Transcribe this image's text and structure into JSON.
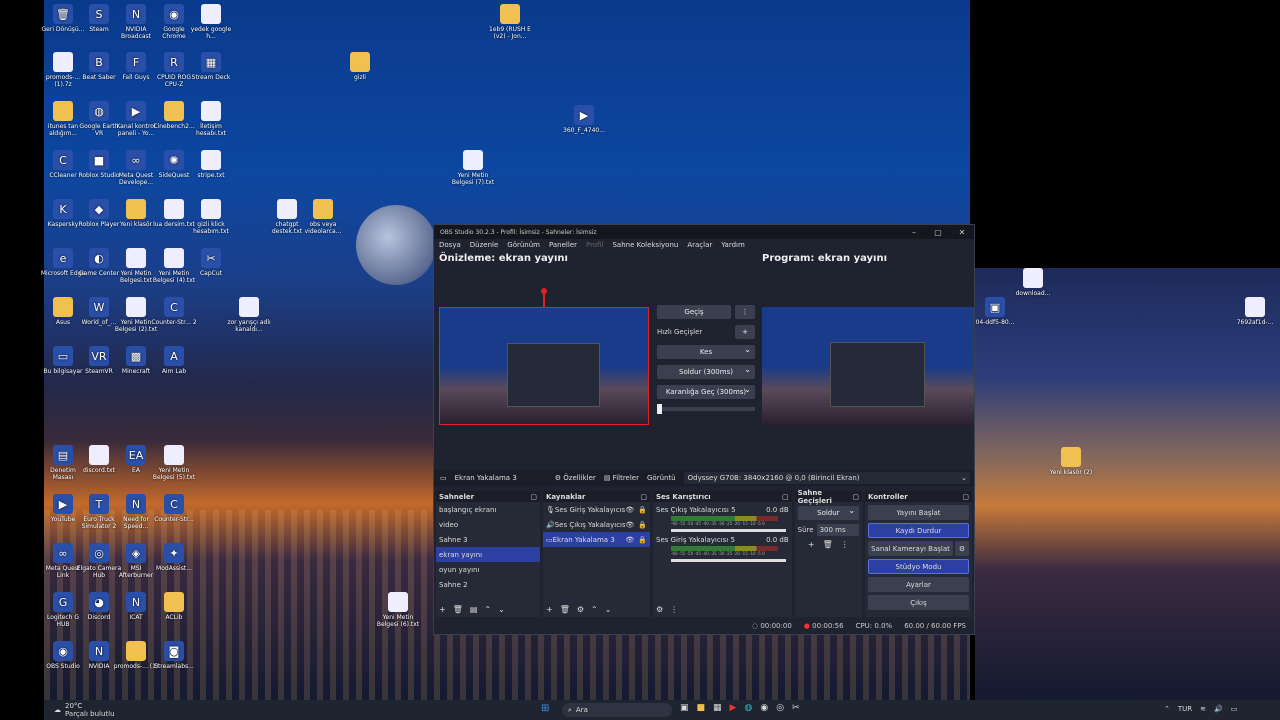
{
  "desktop": {
    "icons": [
      {
        "label": "Geri Dönüşü...",
        "glyph": "🗑",
        "kind": "app"
      },
      {
        "label": "Steam",
        "glyph": "S",
        "kind": "app"
      },
      {
        "label": "NVIDIA Broadcast",
        "glyph": "N",
        "kind": "app"
      },
      {
        "label": "Google Chrome",
        "glyph": "◉",
        "kind": "app"
      },
      {
        "label": "yedek google h...",
        "glyph": "",
        "kind": "file"
      },
      {
        "label": "promods-... (1).7z",
        "glyph": "",
        "kind": "file"
      },
      {
        "label": "Beat Saber",
        "glyph": "B",
        "kind": "app"
      },
      {
        "label": "Fall Guys",
        "glyph": "F",
        "kind": "app"
      },
      {
        "label": "CPUID ROG CPU-Z",
        "glyph": "R",
        "kind": "app"
      },
      {
        "label": "Stream Deck",
        "glyph": "▦",
        "kind": "app"
      },
      {
        "label": "itunes tan aldığım...",
        "glyph": "",
        "kind": "folder"
      },
      {
        "label": "Google Earth VR",
        "glyph": "◍",
        "kind": "app"
      },
      {
        "label": "Kanal kontrol paneli - Yo...",
        "glyph": "▶",
        "kind": "app"
      },
      {
        "label": "Cinebench2...",
        "glyph": "",
        "kind": "folder"
      },
      {
        "label": "İletişim hesabı.txt",
        "glyph": "",
        "kind": "file"
      },
      {
        "label": "CCleaner",
        "glyph": "C",
        "kind": "app"
      },
      {
        "label": "Roblox Studio",
        "glyph": "■",
        "kind": "app"
      },
      {
        "label": "Meta Quest Develope...",
        "glyph": "∞",
        "kind": "app"
      },
      {
        "label": "SideQuest",
        "glyph": "✺",
        "kind": "app"
      },
      {
        "label": "stripe.txt",
        "glyph": "",
        "kind": "file"
      },
      {
        "label": "Kaspersky",
        "glyph": "K",
        "kind": "app"
      },
      {
        "label": "Roblox Player",
        "glyph": "◆",
        "kind": "app"
      },
      {
        "label": "Yeni klasör",
        "glyph": "",
        "kind": "folder"
      },
      {
        "label": "lua dersim.txt",
        "glyph": "",
        "kind": "file"
      },
      {
        "label": "gizli klick hesabım.txt",
        "glyph": "",
        "kind": "file"
      },
      {
        "label": "Microsoft Edge",
        "glyph": "e",
        "kind": "app"
      },
      {
        "label": "Game Center",
        "glyph": "◐",
        "kind": "app"
      },
      {
        "label": "Yeni Metin Belgesi.txt",
        "glyph": "",
        "kind": "file"
      },
      {
        "label": "Yeni Metin Belgesi (4).txt",
        "glyph": "",
        "kind": "file"
      },
      {
        "label": "CapCut",
        "glyph": "✂",
        "kind": "app"
      },
      {
        "label": "Asus",
        "glyph": "",
        "kind": "folder"
      },
      {
        "label": "World_of_...",
        "glyph": "W",
        "kind": "app"
      },
      {
        "label": "Yeni Metin Belgesi (2).txt",
        "glyph": "",
        "kind": "file"
      },
      {
        "label": "Counter-Str... 2",
        "glyph": "C",
        "kind": "app"
      },
      {
        "label": "Bu bilgisayar",
        "glyph": "▭",
        "kind": "app"
      },
      {
        "label": "SteamVR",
        "glyph": "VR",
        "kind": "app"
      },
      {
        "label": "Minecraft",
        "glyph": "▩",
        "kind": "app"
      },
      {
        "label": "Aim Lab",
        "glyph": "A",
        "kind": "app"
      },
      {
        "label": "Denetim Masası",
        "glyph": "▤",
        "kind": "app"
      },
      {
        "label": "discord.txt",
        "glyph": "",
        "kind": "file"
      },
      {
        "label": "EA",
        "glyph": "EA",
        "kind": "app"
      },
      {
        "label": "Yeni Metin Belgesi (5).txt",
        "glyph": "",
        "kind": "file"
      },
      {
        "label": "YouTube",
        "glyph": "▶",
        "kind": "app"
      },
      {
        "label": "Euro Truck Simulator 2",
        "glyph": "T",
        "kind": "app"
      },
      {
        "label": "Need for Speed...",
        "glyph": "N",
        "kind": "app"
      },
      {
        "label": "Counter-Str...",
        "glyph": "C",
        "kind": "app"
      },
      {
        "label": "Meta Quest Link",
        "glyph": "∞",
        "kind": "app"
      },
      {
        "label": "Elgato Camera Hub",
        "glyph": "◎",
        "kind": "app"
      },
      {
        "label": "MSI Afterburner",
        "glyph": "◈",
        "kind": "app"
      },
      {
        "label": "ModAssist...",
        "glyph": "✦",
        "kind": "app"
      },
      {
        "label": "Logitech G HUB",
        "glyph": "G",
        "kind": "app"
      },
      {
        "label": "Discord",
        "glyph": "◕",
        "kind": "app"
      },
      {
        "label": "ICAT",
        "glyph": "N",
        "kind": "app"
      },
      {
        "label": "ACLib",
        "glyph": "",
        "kind": "folder"
      },
      {
        "label": "OBS Studio",
        "glyph": "◉",
        "kind": "app"
      },
      {
        "label": "NVIDIA",
        "glyph": "N",
        "kind": "app"
      },
      {
        "label": "promods-... (1)",
        "glyph": "",
        "kind": "folder"
      },
      {
        "label": "Streamlabs...",
        "glyph": "◙",
        "kind": "app"
      },
      {
        "label": "1eb9 (RUSH E (v2) - Jon...",
        "glyph": "",
        "kind": "folder"
      },
      {
        "label": "gizli",
        "glyph": "",
        "kind": "folder"
      },
      {
        "label": "360_F_4740...",
        "glyph": "▶",
        "kind": "app"
      },
      {
        "label": "Yeni Metin Belgesi (7).txt",
        "glyph": "",
        "kind": "file"
      },
      {
        "label": "chatgpt destek.txt",
        "glyph": "",
        "kind": "file"
      },
      {
        "label": "obs veya videolarca...",
        "glyph": "",
        "kind": "folder"
      },
      {
        "label": "zor yarışçı adlı kanaldı...",
        "glyph": "",
        "kind": "file"
      },
      {
        "label": "Yeni Metin Belgesi (6).txt",
        "glyph": "",
        "kind": "file"
      },
      {
        "label": "download...",
        "glyph": "",
        "kind": "file"
      },
      {
        "label": "04-ddf5-80...",
        "glyph": "▣",
        "kind": "app"
      },
      {
        "label": "7692af1d-...",
        "glyph": "",
        "kind": "file"
      },
      {
        "label": "Yeni klasör (2)",
        "glyph": "",
        "kind": "folder"
      }
    ]
  },
  "obs": {
    "title": "OBS Studio 30.2.3 - Profil: İsimsiz - Sahneler: İsimsiz",
    "menu": [
      "Dosya",
      "Düzenle",
      "Görünüm",
      "Paneller",
      "Profil",
      "Sahne Koleksiyonu",
      "Araçlar",
      "Yardım"
    ],
    "preview_header": "Önizleme: ekran yayını",
    "program_header": "Program: ekran yayını",
    "transitions": {
      "gecis": "Geçiş",
      "hizli": "Hızlı Geçişler",
      "kes": "Kes",
      "soldur": "Soldur (300ms)",
      "karanlik": "Karanlığa Geç (300ms)"
    },
    "source_bar": {
      "source": "Ekran Yakalama 3",
      "ozellikler": "Özellikler",
      "filtreler": "Filtreler",
      "goruntu_label": "Görüntü",
      "goruntu_value": "Odyssey G70B: 3840x2160 @ 0,0 (Birincil Ekran)"
    },
    "scenes": {
      "title": "Sahneler",
      "items": [
        "başlangıç ekranı",
        "video",
        "Sahne 3",
        "ekran yayını",
        "oyun yayını",
        "Sahne 2"
      ],
      "active": 3
    },
    "sources": {
      "title": "Kaynaklar",
      "items": [
        "Ses Giriş Yakalayıcısı",
        "Ses Çıkış Yakalayıcısı",
        "Ekran Yakalama 3"
      ]
    },
    "mixer": {
      "title": "Ses Karıştırıcı",
      "channels": [
        {
          "name": "Ses Çıkış Yakalayıcısı 5",
          "db": "0.0 dB"
        },
        {
          "name": "Ses Giriş Yakalayıcısı 5",
          "db": "0.0 dB"
        }
      ],
      "scale": "-60 -55 -50 -45 -40 -35 -30 -25 -20 -15 -10 -5 0"
    },
    "scene_transitions": {
      "title": "Sahne Geçişleri",
      "type": "Soldur",
      "duration_label": "Süre",
      "duration": "300 ms"
    },
    "controls": {
      "title": "Kontroller",
      "start_stream": "Yayını Başlat",
      "stop_record": "Kaydı Durdur",
      "virtual_cam": "Sanal Kamerayı Başlat",
      "studio_mode": "Stüdyo Modu",
      "settings": "Ayarlar",
      "exit": "Çıkış"
    },
    "status": {
      "stream_time": "00:00:00",
      "record_time": "00:00:56",
      "cpu": "CPU: 0.0%",
      "fps": "60.00 / 60.00 FPS"
    }
  },
  "taskbar": {
    "weather_temp": "20°C",
    "weather_text": "Parçalı bulutlu",
    "search": "Ara",
    "lang": "TUR"
  }
}
